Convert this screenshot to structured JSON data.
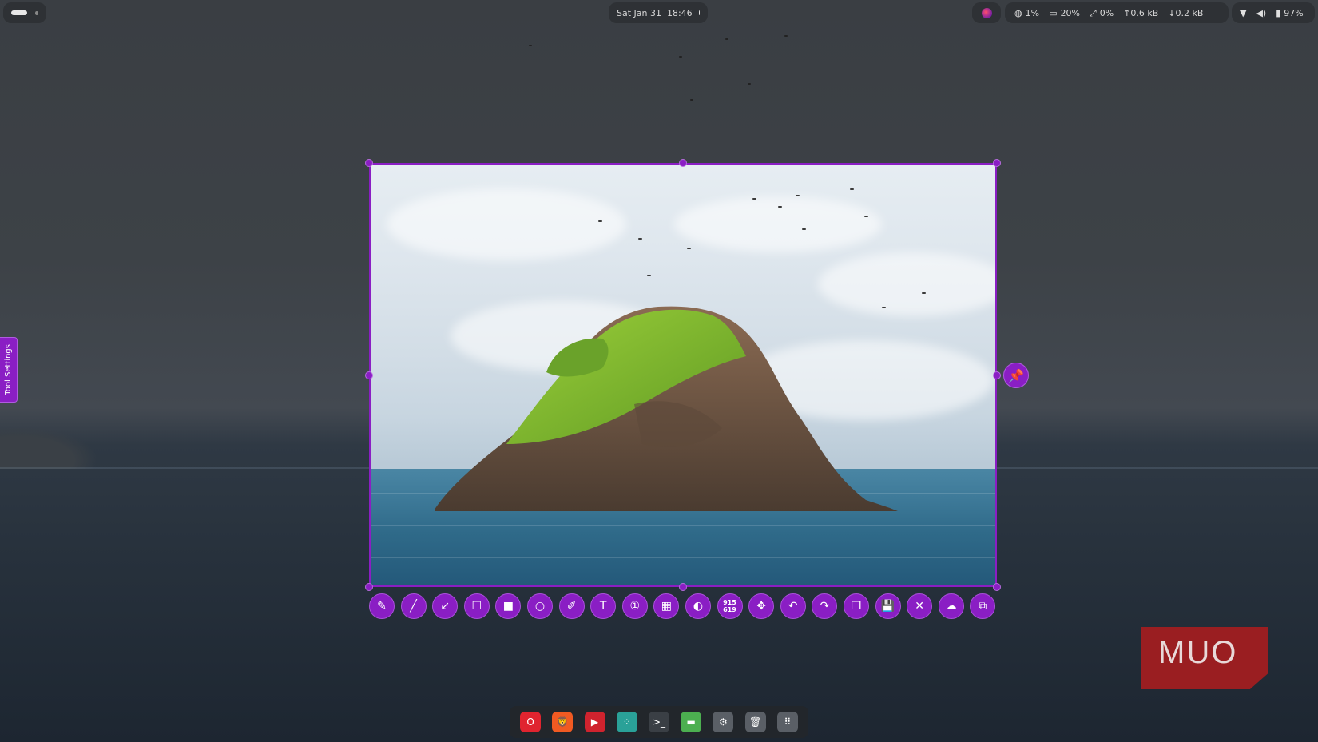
{
  "topbar": {
    "clock": "Sat Jan 31  18:46",
    "stats": {
      "cpu": "1%",
      "memory": "20%",
      "gpu": "0%",
      "upload": "↑0.6 kB",
      "download": "↓0.2 kB"
    },
    "battery": "97%",
    "icons": {
      "cpu": "globe-icon",
      "memory": "memory-icon",
      "gpu": "pipe-icon",
      "wifi": "wifi-icon",
      "volume": "volume-icon",
      "battery": "battery-icon"
    }
  },
  "tool_settings": {
    "label": "Tool Settings"
  },
  "selection": {
    "size_width": "915",
    "size_height": "619"
  },
  "toolbar": {
    "tools": [
      {
        "name": "pencil-tool",
        "icon": "pencil-icon",
        "glyph": "✎"
      },
      {
        "name": "line-tool",
        "icon": "line-icon",
        "glyph": "╱"
      },
      {
        "name": "arrow-tool",
        "icon": "arrow-icon",
        "glyph": "↙"
      },
      {
        "name": "rectangle-outline-tool",
        "icon": "square-outline-icon",
        "glyph": "☐"
      },
      {
        "name": "rectangle-filled-tool",
        "icon": "square-filled-icon",
        "glyph": "■"
      },
      {
        "name": "circle-tool",
        "icon": "circle-icon",
        "glyph": "○"
      },
      {
        "name": "marker-tool",
        "icon": "marker-icon",
        "glyph": "✐"
      },
      {
        "name": "text-tool",
        "icon": "text-icon",
        "glyph": "T"
      },
      {
        "name": "counter-tool",
        "icon": "counter-icon",
        "glyph": "①"
      },
      {
        "name": "pixelate-tool",
        "icon": "pixelate-icon",
        "glyph": "▦"
      },
      {
        "name": "invert-tool",
        "icon": "contrast-icon",
        "glyph": "◐"
      },
      {
        "name": "size-indicator",
        "icon": "size-icon",
        "glyph": ""
      },
      {
        "name": "move-tool",
        "icon": "move-icon",
        "glyph": "✥"
      },
      {
        "name": "undo-button",
        "icon": "undo-icon",
        "glyph": "↶"
      },
      {
        "name": "redo-button",
        "icon": "redo-icon",
        "glyph": "↷"
      },
      {
        "name": "copy-button",
        "icon": "copy-icon",
        "glyph": "❐"
      },
      {
        "name": "save-button",
        "icon": "save-icon",
        "glyph": "💾"
      },
      {
        "name": "close-button",
        "icon": "close-icon",
        "glyph": "✕"
      },
      {
        "name": "upload-button",
        "icon": "cloud-upload-icon",
        "glyph": "☁"
      },
      {
        "name": "open-with-button",
        "icon": "app-launch-icon",
        "glyph": "⧉"
      }
    ]
  },
  "dock": {
    "apps": [
      {
        "name": "opera-app",
        "icon": "opera-icon",
        "glyph": "O",
        "color": "#e0242f"
      },
      {
        "name": "brave-app",
        "icon": "brave-lion-icon",
        "glyph": "🦁",
        "color": "#f15a22"
      },
      {
        "name": "media-player-app",
        "icon": "play-icon",
        "glyph": "▶",
        "color": "#d0232e"
      },
      {
        "name": "nodes-app",
        "icon": "nodes-icon",
        "glyph": "⁘",
        "color": "#2aa198"
      },
      {
        "name": "terminal-app",
        "icon": "terminal-icon",
        "glyph": ">_",
        "color": "#3a3f45"
      },
      {
        "name": "files-app",
        "icon": "folder-icon",
        "glyph": "▬",
        "color": "#4caf50"
      },
      {
        "name": "settings-app",
        "icon": "gear-icon",
        "glyph": "⚙",
        "color": "#5a5f66"
      },
      {
        "name": "trash-app",
        "icon": "trash-icon",
        "glyph": "🗑",
        "color": "#5a5f66"
      },
      {
        "name": "app-grid",
        "icon": "grid-icon",
        "glyph": "⠿",
        "color": "#5a5f66"
      }
    ]
  },
  "watermark": {
    "text": "MUO"
  }
}
